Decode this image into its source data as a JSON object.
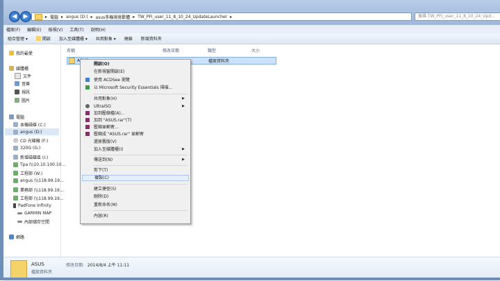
{
  "address": {
    "crumbs": [
      "電腦",
      "angus (D:)",
      "asus手機視覺歡體",
      "TW_PFI_user_11_8_10_24_UpdateLauncher"
    ],
    "sep": "▸",
    "search_placeholder": "搜尋 TW_PFI_user_11_8_10_24_Upd..."
  },
  "menubar": [
    "檔案(F)",
    "編輯(E)",
    "檢視(V)",
    "工具(T)",
    "說明(H)"
  ],
  "toolbar": [
    "組合管理 ▾",
    "開啟",
    "加入至媒體櫃 ▾",
    "共用對象 ▾",
    "燒錄",
    "新增資料夾"
  ],
  "sidebar": {
    "favorites": "我的最愛",
    "libraries": "媒體櫃",
    "lib_items": [
      "文件",
      "音樂",
      "視訊",
      "圖片"
    ],
    "computer": "電腦",
    "drives": [
      "本機磁碟 (C:)",
      "angus (D:)",
      "CD 光碟機 (F:)",
      "320G (G:)",
      "新增磁碟區 (I:)",
      "Tpa (\\\\10.10.100.10...",
      "工程部 (W:)",
      "angus (\\\\118.99.19...",
      "業務部 (\\\\118.99.19...",
      "工程部 (\\\\118.99.19...",
      "PadFone Infinity",
      "GARMIN MAP",
      "內部儲存空間"
    ],
    "network": "網路"
  },
  "columns": [
    "名稱",
    "修改日期",
    "類型",
    "大小"
  ],
  "file": {
    "name": "ASUS",
    "type": "檔案資料夾"
  },
  "context_menu": {
    "items": [
      "開啟(O)",
      "在新視窗開啟(E)",
      "使用 ACDSee 瀏覽",
      "以 Microsoft Security Essentials 掃描...",
      "共用對象(H)",
      "UltraISO",
      "加到壓縮檔(A)...",
      "加到 \"ASUS.rar\"(T)",
      "壓縮並郵寄...",
      "壓縮成 \"ASUS.rar\" 並郵寄",
      "還原舊版(V)",
      "加入至媒體櫃(I)",
      "傳送到(N)",
      "剪下(T)",
      "複製(C)",
      "建立捷徑(S)",
      "刪除(D)",
      "重新命名(M)",
      "內容(R)"
    ]
  },
  "details": {
    "name": "ASUS",
    "modified_label": "修改日期:",
    "modified_value": "2014/8/4 上午 11:11",
    "type": "檔案資料夾"
  },
  "colors": {
    "folder": "#f4d36b",
    "selection": "#cce2fa",
    "highlight": "#e5eef9"
  }
}
